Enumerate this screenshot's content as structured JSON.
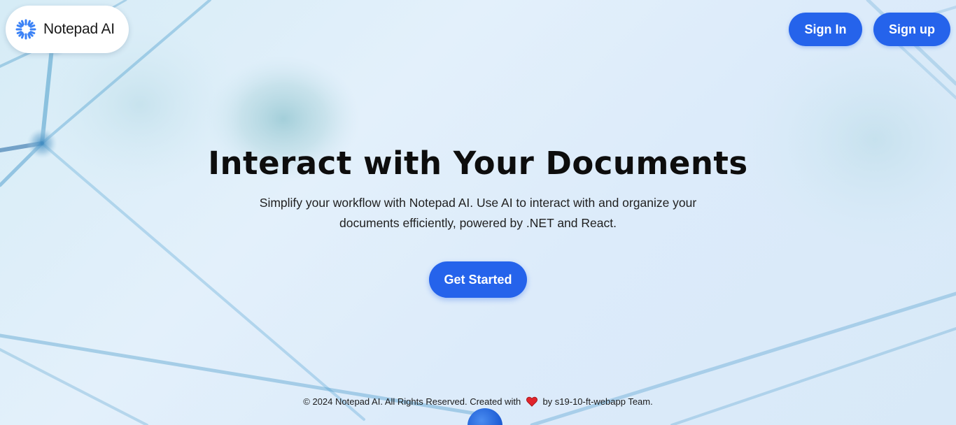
{
  "brand": {
    "name": "Notepad AI",
    "logo_icon": "sunburst-logo-icon",
    "accent_color": "#2563eb"
  },
  "nav": {
    "signin_label": "Sign In",
    "signup_label": "Sign up"
  },
  "hero": {
    "title": "Interact with Your Documents",
    "subtitle": "Simplify your workflow with Notepad AI. Use AI to interact with and organize your documents efficiently, powered by .NET and React.",
    "cta_label": "Get Started"
  },
  "footer": {
    "text_before": "© 2024 Notepad AI. All Rights Reserved. Created with",
    "icon": "heart-icon",
    "text_after": "by s19-10-ft-webapp Team."
  }
}
